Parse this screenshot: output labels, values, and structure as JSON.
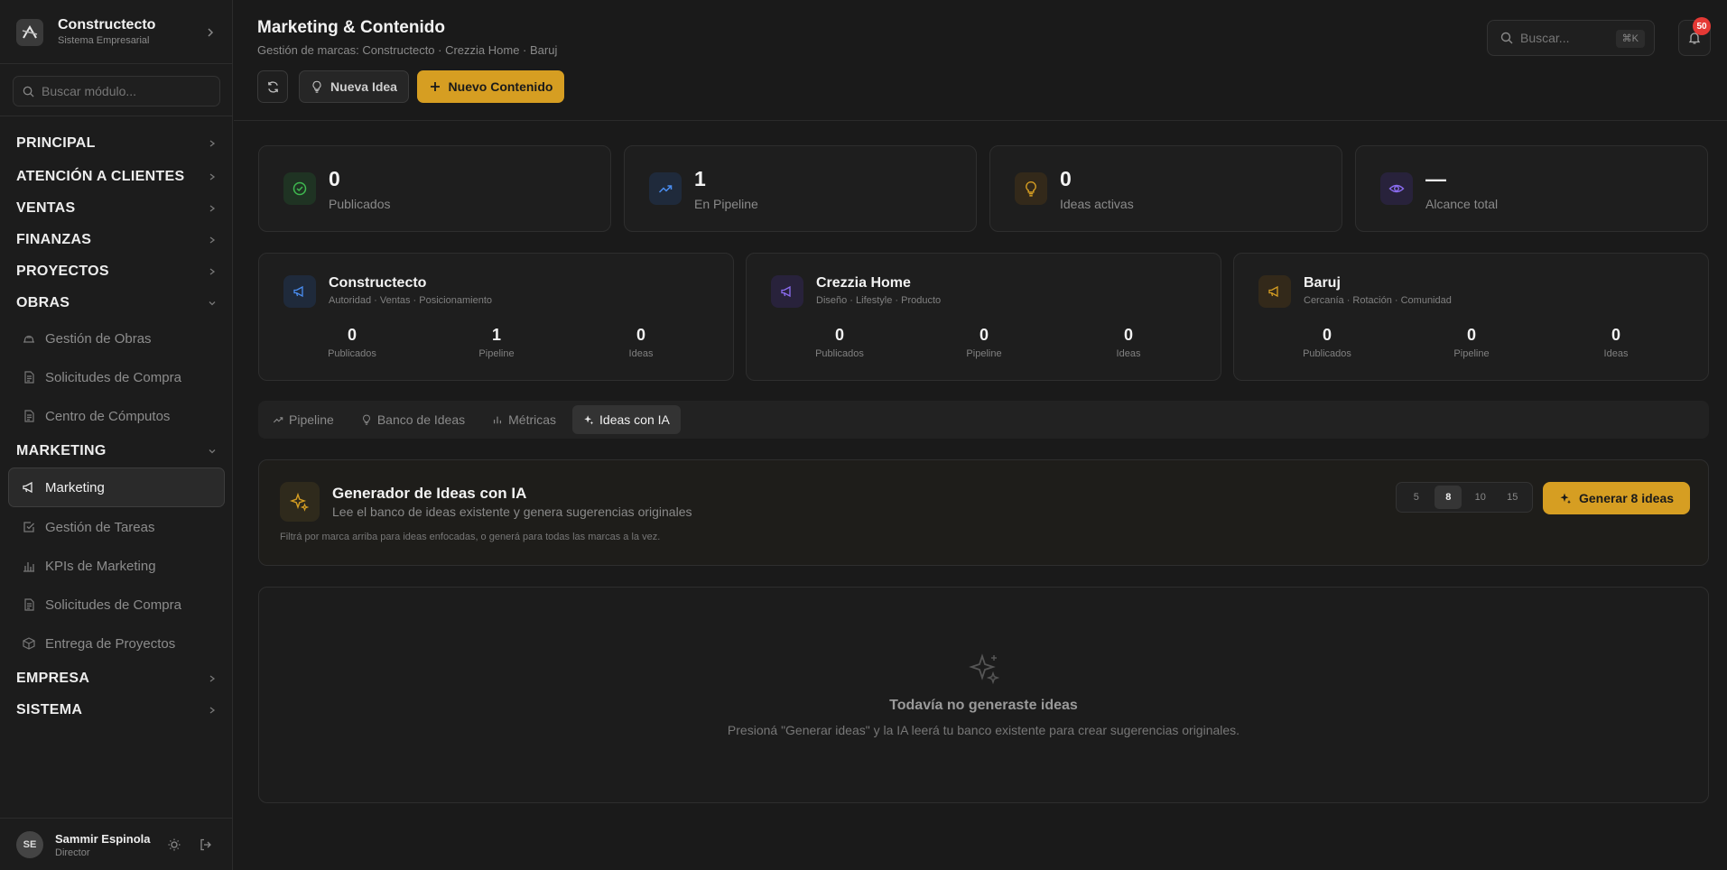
{
  "app": {
    "name": "Constructecto",
    "subtitle": "Sistema Empresarial"
  },
  "sidebar": {
    "search_placeholder": "Buscar módulo...",
    "sections": [
      {
        "label": "PRINCIPAL"
      },
      {
        "label": "ATENCIÓN A CLIENTES"
      },
      {
        "label": "VENTAS"
      },
      {
        "label": "FINANZAS"
      },
      {
        "label": "PROYECTOS"
      },
      {
        "label": "OBRAS"
      },
      {
        "label": "MARKETING"
      },
      {
        "label": "EMPRESA"
      },
      {
        "label": "SISTEMA"
      }
    ],
    "obras_items": [
      {
        "label": "Gestión de Obras",
        "icon": "hardhat-icon"
      },
      {
        "label": "Solicitudes de Compra",
        "icon": "document-icon"
      },
      {
        "label": "Centro de Cómputos",
        "icon": "document-icon"
      }
    ],
    "marketing_items": [
      {
        "label": "Marketing",
        "icon": "megaphone-icon"
      },
      {
        "label": "Gestión de Tareas",
        "icon": "checkbox-icon"
      },
      {
        "label": "KPIs de Marketing",
        "icon": "bar-chart-icon"
      },
      {
        "label": "Solicitudes de Compra",
        "icon": "document-icon"
      },
      {
        "label": "Entrega de Proyectos",
        "icon": "package-icon"
      }
    ]
  },
  "user": {
    "initials": "SE",
    "name": "Sammir Espinola",
    "role": "Director"
  },
  "header": {
    "title": "Marketing & Contenido",
    "subtitle": "Gestión de marcas: Constructecto · Crezzia Home · Baruj",
    "new_idea_label": "Nueva Idea",
    "new_content_label": "Nuevo Contenido",
    "search_placeholder": "Buscar...",
    "search_shortcut": "⌘K",
    "notifications_count": "50"
  },
  "stats": [
    {
      "value": "0",
      "label": "Publicados",
      "icon": "check-circle-icon",
      "color": "#3fb950"
    },
    {
      "value": "1",
      "label": "En Pipeline",
      "icon": "trending-up-icon",
      "color": "#4a8df0"
    },
    {
      "value": "0",
      "label": "Ideas activas",
      "icon": "lightbulb-icon",
      "color": "#d69e22"
    },
    {
      "value": "—",
      "label": "Alcance total",
      "icon": "eye-icon",
      "color": "#8b6cf0"
    }
  ],
  "brands": [
    {
      "name": "Constructecto",
      "tags": "Autoridad · Ventas · Posicionamiento",
      "color": "#4a8df0",
      "stats": [
        {
          "value": "0",
          "label": "Publicados"
        },
        {
          "value": "1",
          "label": "Pipeline"
        },
        {
          "value": "0",
          "label": "Ideas"
        }
      ]
    },
    {
      "name": "Crezzia Home",
      "tags": "Diseño · Lifestyle · Producto",
      "color": "#8b6cf0",
      "stats": [
        {
          "value": "0",
          "label": "Publicados"
        },
        {
          "value": "0",
          "label": "Pipeline"
        },
        {
          "value": "0",
          "label": "Ideas"
        }
      ]
    },
    {
      "name": "Baruj",
      "tags": "Cercanía · Rotación · Comunidad",
      "color": "#d69e22",
      "stats": [
        {
          "value": "0",
          "label": "Publicados"
        },
        {
          "value": "0",
          "label": "Pipeline"
        },
        {
          "value": "0",
          "label": "Ideas"
        }
      ]
    }
  ],
  "tabs": [
    {
      "label": "Pipeline",
      "icon": "trending-up-icon"
    },
    {
      "label": "Banco de Ideas",
      "icon": "lightbulb-icon"
    },
    {
      "label": "Métricas",
      "icon": "bar-chart-icon"
    },
    {
      "label": "Ideas con IA",
      "icon": "sparkles-icon"
    }
  ],
  "active_tab": "Ideas con IA",
  "generator": {
    "title": "Generador de Ideas con IA",
    "subtitle": "Lee el banco de ideas existente y genera sugerencias originales",
    "hint": "Filtrá por marca arriba para ideas enfocadas, o generá para todas las marcas a la vez.",
    "counts": [
      "5",
      "8",
      "10",
      "15"
    ],
    "selected_count": "8",
    "button_label": "Generar 8 ideas"
  },
  "empty_state": {
    "title": "Todavía no generaste ideas",
    "subtitle": "Presioná \"Generar ideas\" y la IA leerá tu banco existente para crear sugerencias originales."
  },
  "colors": {
    "accent": "#d69e22",
    "badge": "#e53935"
  }
}
